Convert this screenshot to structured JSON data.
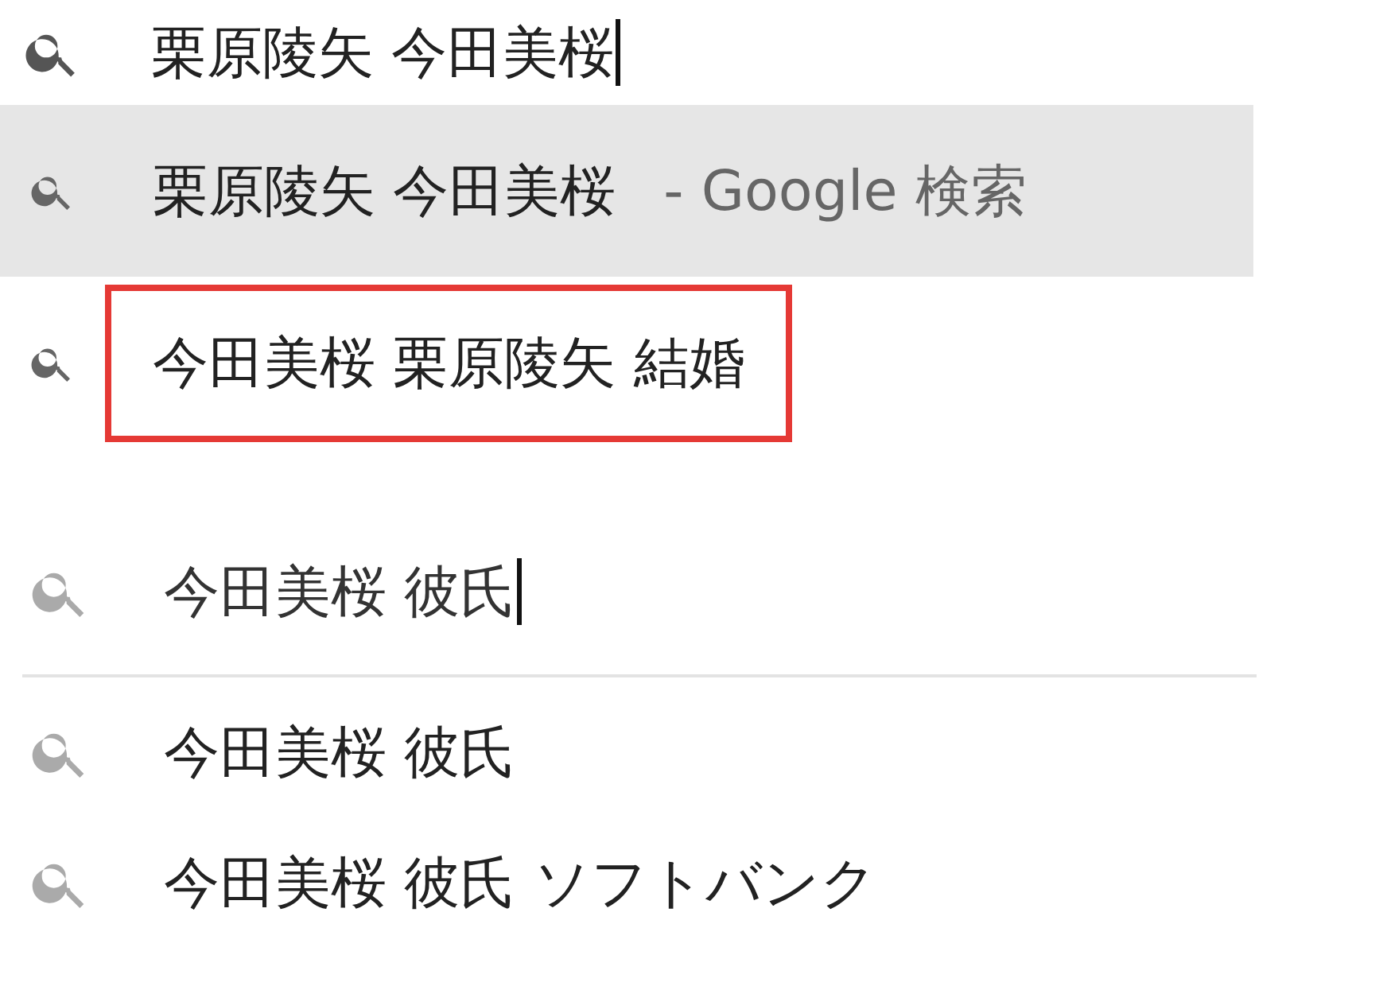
{
  "panels": [
    {
      "query": "栗原陵矢 今田美桜",
      "caret": true,
      "suggestions": [
        {
          "text": "栗原陵矢 今田美桜",
          "suffix": " - Google 検索",
          "selected": true,
          "outlined": false
        },
        {
          "text": "今田美桜 栗原陵矢 結婚",
          "selected": false,
          "outlined": true
        }
      ]
    },
    {
      "query": "今田美桜 彼氏",
      "caret": true,
      "divider": true,
      "suggestions": [
        {
          "text": "今田美桜 彼氏",
          "selected": false
        },
        {
          "text": "今田美桜 彼氏 ソフトバンク",
          "selected": false
        }
      ]
    }
  ]
}
